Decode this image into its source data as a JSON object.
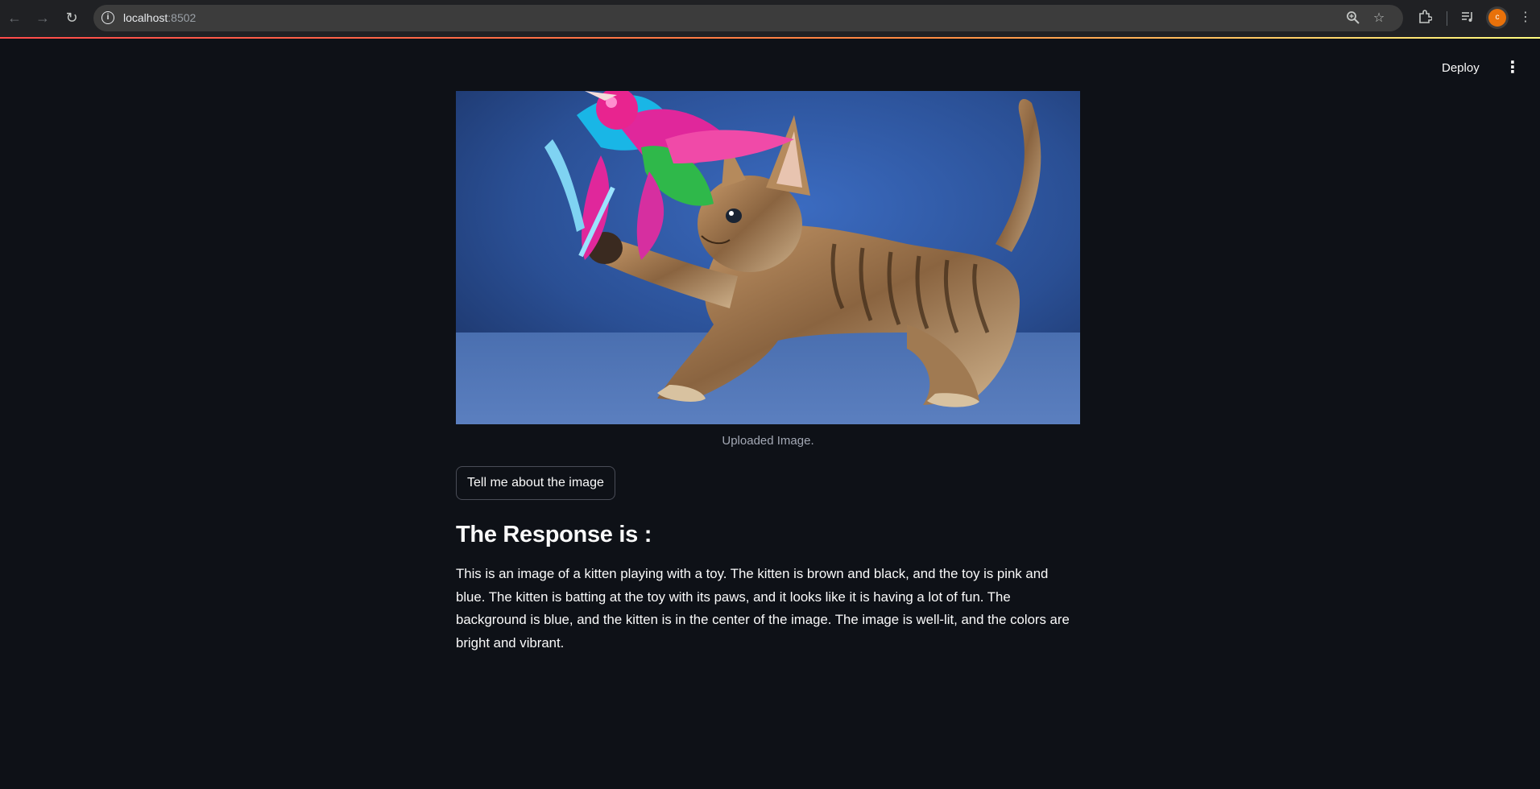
{
  "browser": {
    "url_host": "localhost",
    "url_port": ":8502",
    "profile_initial": "c"
  },
  "header": {
    "deploy_label": "Deploy"
  },
  "main": {
    "image_caption": "Uploaded Image.",
    "button_label": "Tell me about the image",
    "response_heading": "The Response is :",
    "response_text": "This is an image of a kitten playing with a toy. The kitten is brown and black, and the toy is pink and blue. The kitten is batting at the toy with its paws, and it looks like it is having a lot of fun. The background is blue, and the kitten is in the center of the image. The image is well-lit, and the colors are bright and vibrant."
  },
  "colors": {
    "background": "#0e1117",
    "text": "#fafafa",
    "accent_gradient_start": "#ff4b4b"
  }
}
